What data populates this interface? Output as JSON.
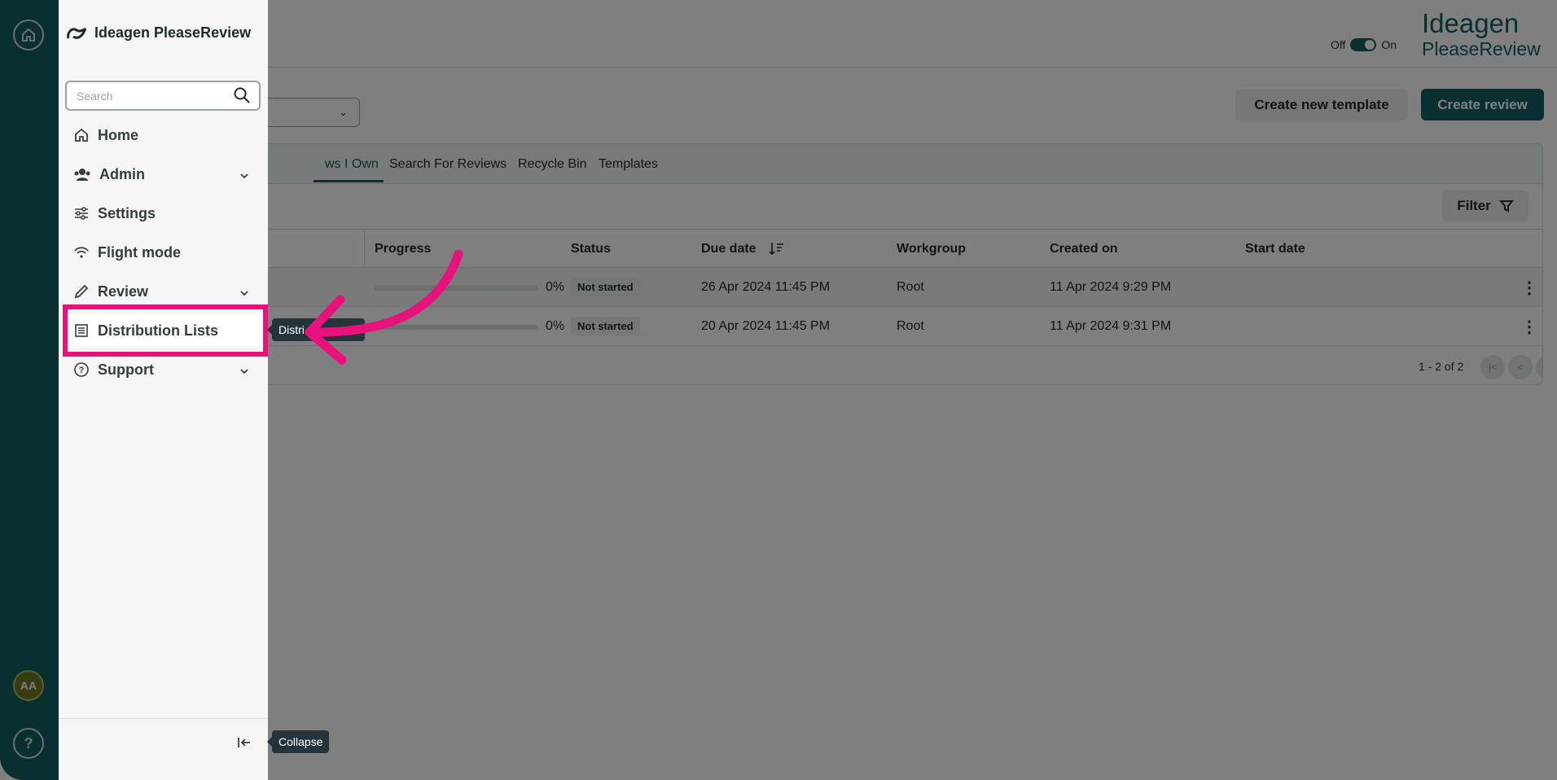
{
  "app": {
    "brand_name": "Ideagen PleaseReview",
    "logo_line1": "Ideagen",
    "logo_line2": "PleaseReview",
    "accent_color": "#135e63",
    "annotation_color": "#e8127c"
  },
  "header": {
    "toggle_off_label": "Off",
    "toggle_on_label": "On",
    "toggle_state": "on"
  },
  "actions": {
    "create_template_label": "Create new template",
    "create_review_label": "Create review"
  },
  "tabs": {
    "items": [
      {
        "label": "ws I Own",
        "active": true
      },
      {
        "label": "Search For Reviews",
        "active": false
      },
      {
        "label": "Recycle Bin",
        "active": false
      },
      {
        "label": "Templates",
        "active": false
      }
    ]
  },
  "filter": {
    "label": "Filter",
    "icon": "filter-icon"
  },
  "table": {
    "headers": {
      "progress": "Progress",
      "status": "Status",
      "due_date": "Due date",
      "workgroup": "Workgroup",
      "created_on": "Created on",
      "start_date": "Start date"
    },
    "rows": [
      {
        "progress_value": 0,
        "progress_label": "0%",
        "status": "Not started",
        "due_date": "26 Apr 2024 11:45 PM",
        "workgroup": "Root",
        "created_on": "11 Apr 2024 9:29 PM",
        "start_date": ""
      },
      {
        "progress_value": 0,
        "progress_label": "0%",
        "status": "Not started",
        "due_date": "20 Apr 2024 11:45 PM",
        "workgroup": "Root",
        "created_on": "11 Apr 2024 9:31 PM",
        "start_date": ""
      }
    ],
    "pagination_text": "1 - 2 of 2"
  },
  "sidebar": {
    "search_placeholder": "Search",
    "items": [
      {
        "label": "Home",
        "icon": "home-icon",
        "expandable": false
      },
      {
        "label": "Admin",
        "icon": "users-icon",
        "expandable": true
      },
      {
        "label": "Settings",
        "icon": "sliders-icon",
        "expandable": false
      },
      {
        "label": "Flight mode",
        "icon": "wifi-icon",
        "expandable": false
      },
      {
        "label": "Review",
        "icon": "pencil-icon",
        "expandable": true
      },
      {
        "label": "Distribution Lists",
        "icon": "list-icon",
        "expandable": false,
        "selected": true
      },
      {
        "label": "Support",
        "icon": "help-circle-icon",
        "expandable": true
      }
    ],
    "tooltip_text": "Distri",
    "collapse_tooltip": "Collapse"
  },
  "user": {
    "initials": "AA"
  }
}
